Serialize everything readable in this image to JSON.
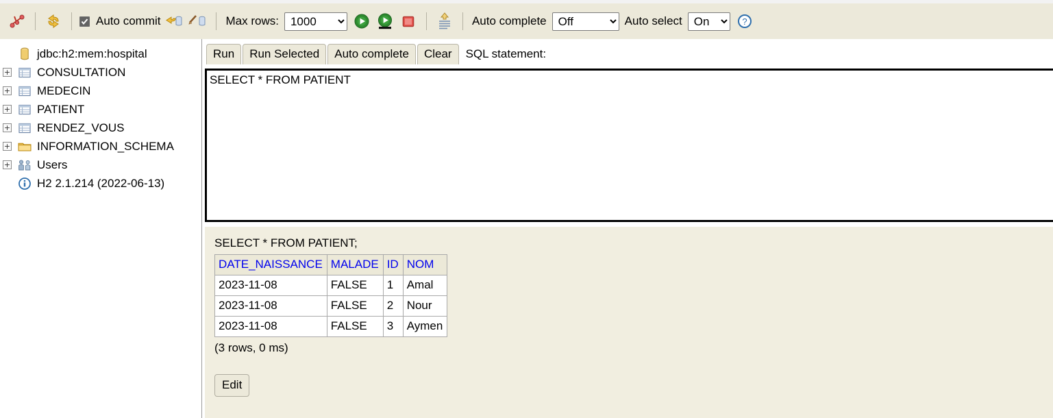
{
  "toolbar": {
    "disconnect_icon": "disconnect-icon",
    "refresh_icon": "refresh-icon",
    "auto_commit_label": "Auto commit",
    "auto_commit_checked": true,
    "rollback_icon": "rollback-icon",
    "commit_icon": "commit-icon",
    "max_rows_label": "Max rows:",
    "max_rows_value": "1000",
    "max_rows_options": [
      "1000"
    ],
    "run_icon": "run-icon",
    "run_selected_icon": "run-selected-icon",
    "stop_icon": "stop-icon",
    "script_icon": "script-icon",
    "auto_complete_label": "Auto complete",
    "auto_complete_value": "Off",
    "auto_complete_options": [
      "Off"
    ],
    "auto_select_label": "Auto select",
    "auto_select_value": "On",
    "auto_select_options": [
      "On"
    ],
    "help_icon": "help-icon"
  },
  "sidebar": {
    "items": [
      {
        "label": "jdbc:h2:mem:hospital",
        "icon": "database-icon",
        "expandable": false,
        "expander": ""
      },
      {
        "label": "CONSULTATION",
        "icon": "table-icon",
        "expandable": true,
        "expander": "+"
      },
      {
        "label": "MEDECIN",
        "icon": "table-icon",
        "expandable": true,
        "expander": "+"
      },
      {
        "label": "PATIENT",
        "icon": "table-icon",
        "expandable": true,
        "expander": "+"
      },
      {
        "label": "RENDEZ_VOUS",
        "icon": "table-icon",
        "expandable": true,
        "expander": "+"
      },
      {
        "label": "INFORMATION_SCHEMA",
        "icon": "folder-icon",
        "expandable": true,
        "expander": "+"
      },
      {
        "label": "Users",
        "icon": "users-icon",
        "expandable": true,
        "expander": "+"
      },
      {
        "label": "H2 2.1.214 (2022-06-13)",
        "icon": "info-icon",
        "expandable": false,
        "expander": ""
      }
    ]
  },
  "sql_panel": {
    "run_label": "Run",
    "run_selected_label": "Run Selected",
    "auto_complete_label": "Auto complete",
    "clear_label": "Clear",
    "statement_label": "SQL statement:",
    "statement_value": "SELECT * FROM PATIENT "
  },
  "results": {
    "query_echo": "SELECT * FROM PATIENT;",
    "columns": [
      "DATE_NAISSANCE",
      "MALADE",
      "ID",
      "NOM"
    ],
    "rows": [
      [
        "2023-11-08",
        "FALSE",
        "1",
        "Amal"
      ],
      [
        "2023-11-08",
        "FALSE",
        "2",
        "Nour"
      ],
      [
        "2023-11-08",
        "FALSE",
        "3",
        "Aymen"
      ]
    ],
    "status": "(3 rows, 0 ms)",
    "edit_label": "Edit"
  },
  "colors": {
    "toolbar_bg": "#ece9da",
    "results_bg": "#f1eee0",
    "header_text": "#0000ee",
    "table_header_bg": "#ece9d8"
  }
}
